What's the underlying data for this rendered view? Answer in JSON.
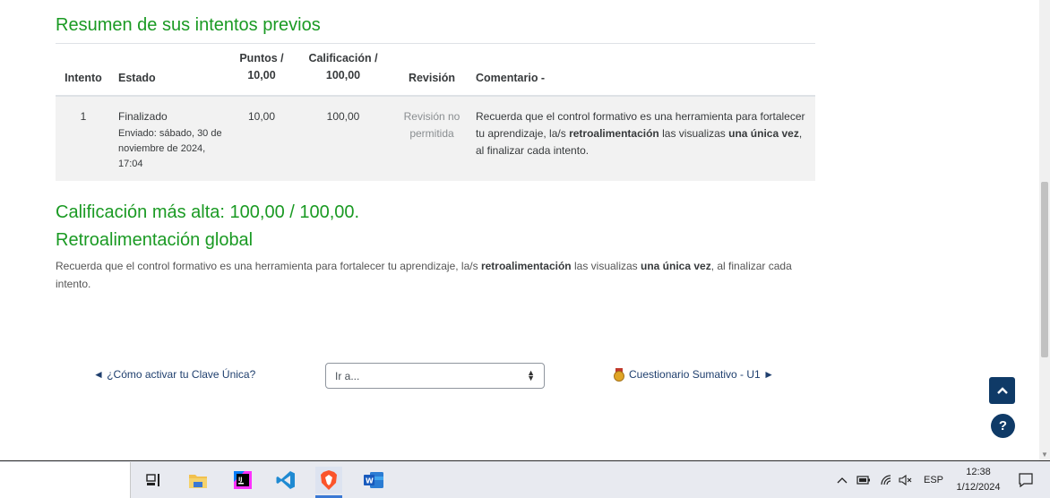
{
  "summary_title": "Resumen de sus intentos previos",
  "table": {
    "headers": {
      "attempt": "Intento",
      "state": "Estado",
      "points_line1": "Puntos /",
      "points_line2": "10,00",
      "grade_line1": "Calificación /",
      "grade_line2": "100,00",
      "review": "Revisión",
      "comment": "Comentario -"
    },
    "rows": [
      {
        "attempt": "1",
        "state": "Finalizado",
        "sent": "Enviado: sábado, 30 de noviembre de 2024, 17:04",
        "points": "10,00",
        "grade": "100,00",
        "review": "Revisión no permitida",
        "comment_part1": "Recuerda que el control formativo es una herramienta para fortalecer tu aprendizaje, la/s ",
        "comment_bold1": "retroalimentación",
        "comment_part2": " las visualizas ",
        "comment_bold2": "una única vez",
        "comment_part3": ", al finalizar cada intento."
      }
    ]
  },
  "best_grade": "Calificación más alta: 100,00 / 100,00.",
  "global_feedback": {
    "title": "Retroalimentación global",
    "part1": "Recuerda que el control formativo es una herramienta para fortalecer tu aprendizaje, la/s ",
    "bold1": "retroalimentación",
    "part2": " las visualizas ",
    "bold2": "una única vez",
    "part3": ", al finalizar cada intento."
  },
  "navigation": {
    "prev_label": "◄ ¿Cómo activar tu Clave Única?",
    "jump_placeholder": "Ir a...",
    "next_label": "Cuestionario Sumativo -  U1 ►"
  },
  "help_label": "?",
  "taskbar": {
    "apps": [
      "task-view",
      "file-explorer",
      "intellij-idea",
      "vs-code",
      "brave-browser",
      "microsoft-word"
    ],
    "language": "ESP",
    "time": "12:38",
    "date": "1/12/2024"
  },
  "colors": {
    "heading_green": "#1a9a23",
    "nav_blue": "#1f3f6e",
    "button_navy": "#0f3a67",
    "row_bg": "#f2f2f2"
  }
}
